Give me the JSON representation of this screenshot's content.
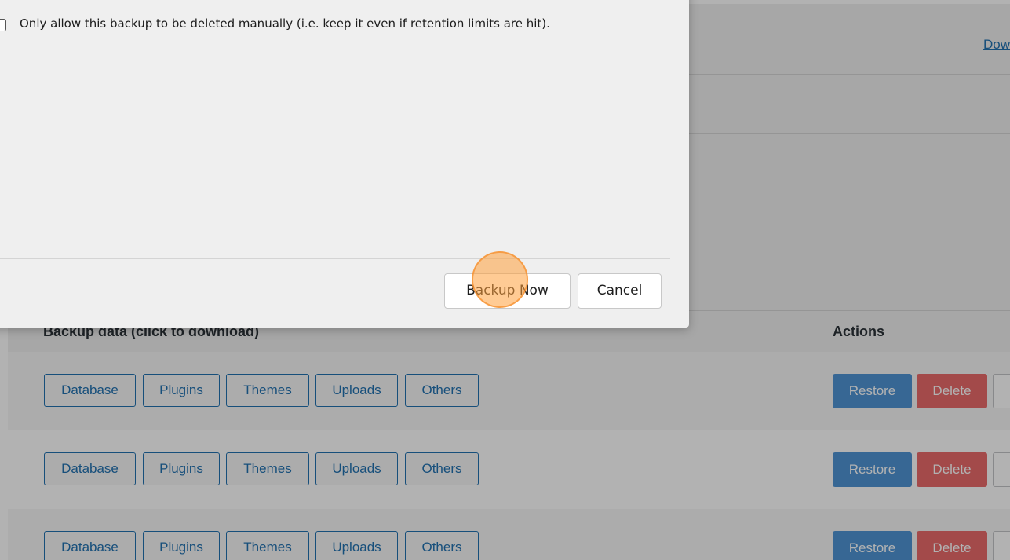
{
  "modal": {
    "retain_label": "Only allow this backup to be deleted manually (i.e. keep it even if retention limits are hit).",
    "backup_now_label": "Backup Now",
    "cancel_label": "Cancel"
  },
  "page": {
    "download_link": "Download"
  },
  "table": {
    "header_backup_data": "Backup data (click to download)",
    "header_actions": "Actions",
    "rows": [
      {
        "entities": [
          "Database",
          "Plugins",
          "Themes",
          "Uploads",
          "Others"
        ],
        "restore_label": "Restore",
        "delete_label": "Delete"
      },
      {
        "entities": [
          "Database",
          "Plugins",
          "Themes",
          "Uploads",
          "Others"
        ],
        "restore_label": "Restore",
        "delete_label": "Delete"
      },
      {
        "entities": [
          "Database",
          "Plugins",
          "Themes",
          "Uploads",
          "Others"
        ],
        "restore_label": "Restore",
        "delete_label": "Delete"
      }
    ]
  },
  "colors": {
    "link_blue": "#2271b1",
    "restore_blue": "#4f94d4",
    "delete_red": "#ea6b6b",
    "click_marker_orange": "#f5a04a"
  }
}
